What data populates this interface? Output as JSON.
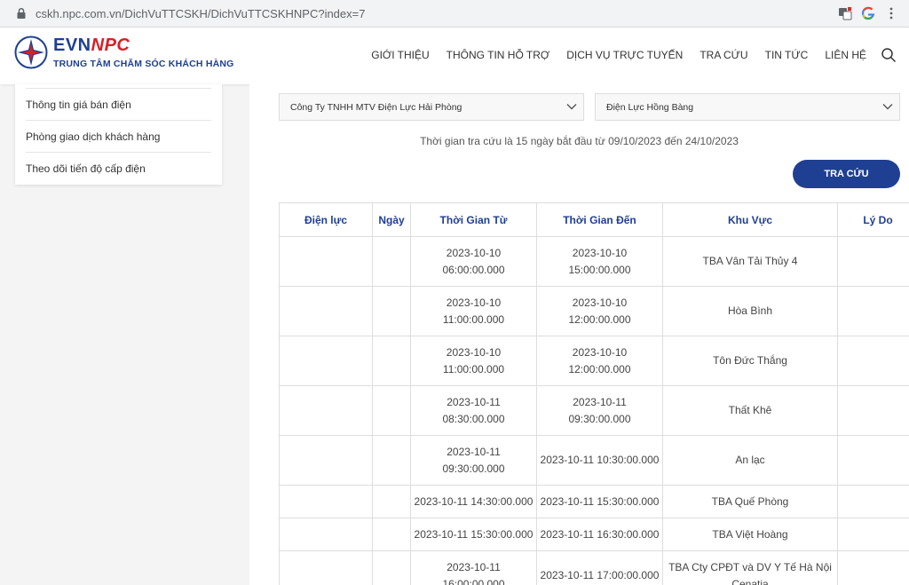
{
  "browser": {
    "url": "cskh.npc.com.vn/DichVuTTCSKH/DichVuTTCSKHNPC?index=7"
  },
  "header": {
    "brand_evn": "EVN",
    "brand_npc": "NPC",
    "tagline": "TRUNG TÂM CHĂM SÓC KHÁCH HÀNG",
    "nav": [
      "GIỚI THIỆU",
      "THÔNG TIN HỖ TRỢ",
      "DỊCH VỤ TRỰC TUYẾN",
      "TRA CỨU",
      "TIN TỨC",
      "LIÊN HỆ"
    ]
  },
  "sidebar": {
    "items": [
      "Thông tin giá bán điện",
      "Phòng giao dịch khách hàng",
      "Theo dõi tiến độ cấp điện"
    ]
  },
  "filters": {
    "company": "Công Ty TNHH MTV Điện Lực Hải Phòng",
    "unit": "Điện Lực Hồng Bàng"
  },
  "info_text": "Thời gian tra cứu là 15 ngày bắt đầu từ 09/10/2023 đến 24/10/2023",
  "search_button": "TRA CỨU",
  "table": {
    "headers": [
      "Điện lực",
      "Ngày",
      "Thời Gian Từ",
      "Thời Gian Đến",
      "Khu Vực",
      "Lý Do"
    ],
    "rows": [
      {
        "dienluc": "",
        "ngay": "",
        "tu": "2023-10-10\n06:00:00.000",
        "den": "2023-10-10\n15:00:00.000",
        "khuvuc": "TBA Vân Tải Thủy 4",
        "lydo": ""
      },
      {
        "dienluc": "",
        "ngay": "",
        "tu": "2023-10-10\n11:00:00.000",
        "den": "2023-10-10\n12:00:00.000",
        "khuvuc": "Hòa Bình",
        "lydo": ""
      },
      {
        "dienluc": "",
        "ngay": "",
        "tu": "2023-10-10\n11:00:00.000",
        "den": "2023-10-10\n12:00:00.000",
        "khuvuc": "Tôn Đức Thắng",
        "lydo": ""
      },
      {
        "dienluc": "",
        "ngay": "",
        "tu": "2023-10-11\n08:30:00.000",
        "den": "2023-10-11\n09:30:00.000",
        "khuvuc": "Thất Khê",
        "lydo": ""
      },
      {
        "dienluc": "",
        "ngay": "",
        "tu": "2023-10-11\n09:30:00.000",
        "den": "2023-10-11 10:30:00.000",
        "khuvuc": "An lạc",
        "lydo": ""
      },
      {
        "dienluc": "",
        "ngay": "",
        "tu": "2023-10-11 14:30:00.000",
        "den": "2023-10-11 15:30:00.000",
        "khuvuc": "TBA Quế Phòng",
        "lydo": ""
      },
      {
        "dienluc": "",
        "ngay": "",
        "tu": "2023-10-11 15:30:00.000",
        "den": "2023-10-11 16:30:00.000",
        "khuvuc": "TBA Việt Hoàng",
        "lydo": ""
      },
      {
        "dienluc": "",
        "ngay": "",
        "tu": "2023-10-11\n16:00:00.000",
        "den": "2023-10-11 17:00:00.000",
        "khuvuc": "TBA Cty CPĐT và DV Y Tế Hà Nội\nCenatia",
        "lydo": ""
      }
    ]
  },
  "colors": {
    "primary": "#1f3f93",
    "accent": "#d72027"
  }
}
